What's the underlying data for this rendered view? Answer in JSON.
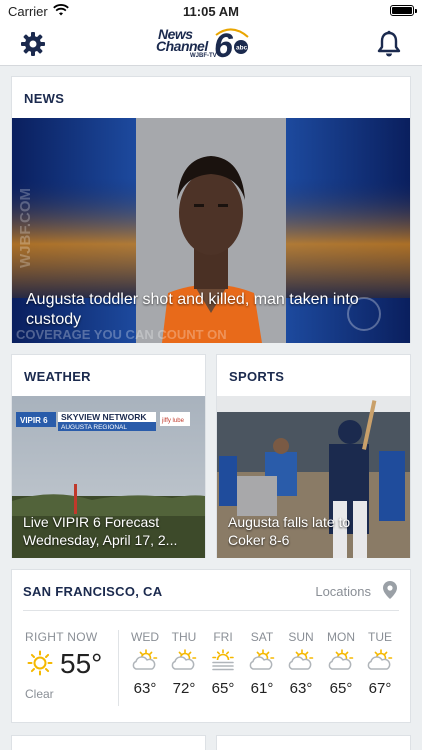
{
  "status_bar": {
    "carrier": "Carrier",
    "time": "11:05 AM"
  },
  "header": {
    "logo_line1": "News",
    "logo_line2": "Channel",
    "logo_callsign": "WJBF-TV",
    "logo_badge": "abc",
    "settings_icon": "gear-icon",
    "notifications_icon": "bell-icon"
  },
  "news": {
    "section_title": "NEWS",
    "headline": "Augusta toddler shot and killed, man taken into custody",
    "watermark_side": "WJBF.COM",
    "watermark_bottom": "COVERAGE YOU CAN COUNT ON"
  },
  "weather": {
    "section_title": "WEATHER",
    "headline": "Live VIPIR 6 Forecast",
    "headline_line2": "Wednesday, April 17, 2...",
    "overlay_title": "SKYVIEW NETWORK",
    "overlay_sub": "AUGUSTA REGIONAL",
    "overlay_badge": "VIPIR 6",
    "overlay_sponsor": "jiffy lube"
  },
  "sports": {
    "section_title": "SPORTS",
    "headline": "Augusta falls late to",
    "headline_line2": "Coker 8-6"
  },
  "forecast": {
    "city": "SAN FRANCISCO, CA",
    "locations_label": "Locations",
    "now_label": "RIGHT NOW",
    "now_temp": "55°",
    "now_condition": "Clear",
    "now_icon": "sun-icon",
    "days": [
      {
        "name": "WED",
        "temp": "63°",
        "icon": "partly-cloudy-icon"
      },
      {
        "name": "THU",
        "temp": "72°",
        "icon": "partly-cloudy-icon"
      },
      {
        "name": "FRI",
        "temp": "65°",
        "icon": "fog-icon"
      },
      {
        "name": "SAT",
        "temp": "61°",
        "icon": "partly-cloudy-icon"
      },
      {
        "name": "SUN",
        "temp": "63°",
        "icon": "partly-cloudy-icon"
      },
      {
        "name": "MON",
        "temp": "65°",
        "icon": "partly-cloudy-icon"
      },
      {
        "name": "TUE",
        "temp": "67°",
        "icon": "partly-cloudy-icon"
      }
    ]
  },
  "colors": {
    "accent": "#1b2a4e",
    "sun": "#f5b800",
    "muted": "#8a8f96"
  }
}
